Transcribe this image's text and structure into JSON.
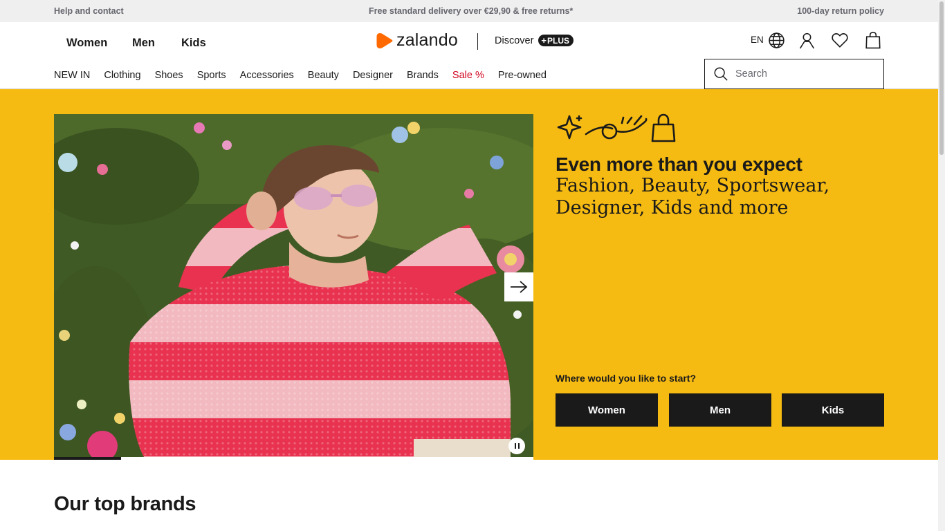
{
  "topbar": {
    "help": "Help and contact",
    "delivery": "Free standard delivery over €29,90 & free returns*",
    "returns": "100-day return policy"
  },
  "header": {
    "gender_nav": [
      "Women",
      "Men",
      "Kids"
    ],
    "logo_text": "zalando",
    "discover_label": "Discover",
    "plus_label": "PLUS",
    "language": "EN",
    "categories": [
      "NEW IN",
      "Clothing",
      "Shoes",
      "Sports",
      "Accessories",
      "Beauty",
      "Designer",
      "Brands",
      "Sale %",
      "Pre-owned"
    ],
    "search_placeholder": "Search"
  },
  "hero": {
    "heading": "Even more than you expect",
    "subheading": "Fashion, Beauty, Sportswear, Designer, Kids and more",
    "start_prompt": "Where would you like to start?",
    "start_buttons": [
      "Women",
      "Men",
      "Kids"
    ],
    "carousel_progress": 0.14
  },
  "sections": {
    "top_brands_title": "Our top brands"
  },
  "colors": {
    "brand_orange": "#ff6900",
    "hero_yellow": "#f6bb12",
    "sale_red": "#d0021b",
    "ink": "#1a1a1a"
  },
  "icons": {
    "logo": "zalando-logo-icon",
    "language": "globe-icon",
    "account": "user-icon",
    "wishlist": "heart-icon",
    "cart": "bag-icon",
    "search": "search-icon",
    "carousel_next": "arrow-right-icon",
    "carousel_pause": "pause-icon"
  }
}
